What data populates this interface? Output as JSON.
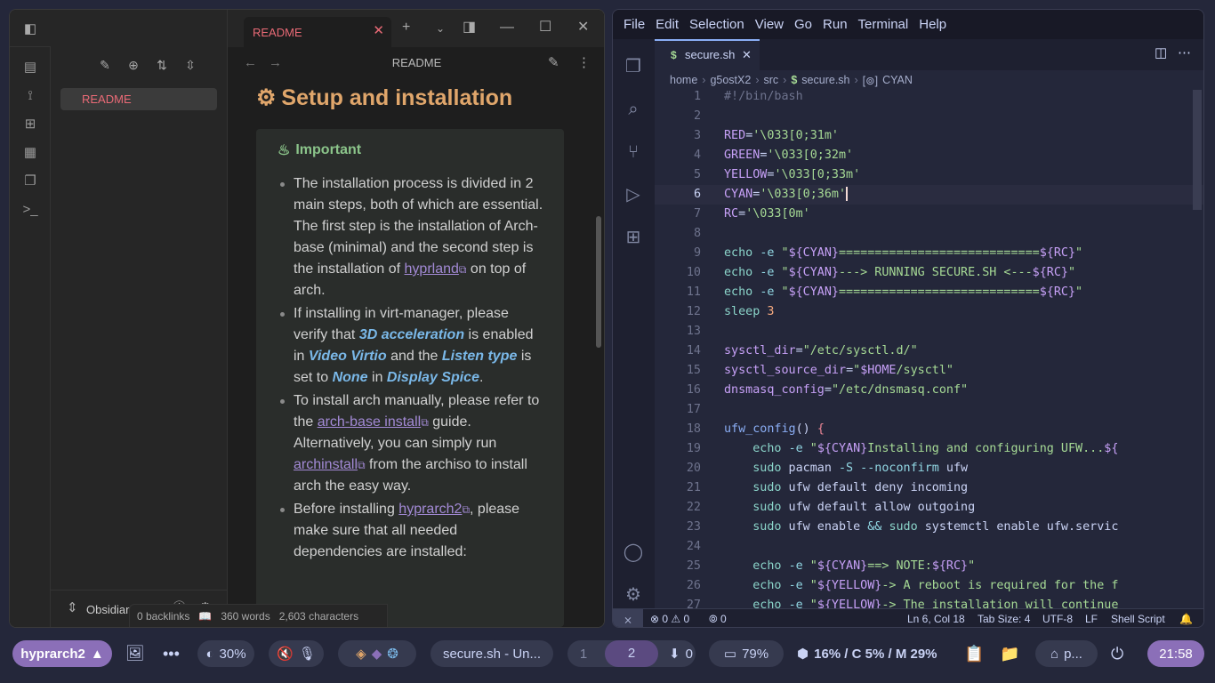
{
  "obsidian": {
    "tab_title": "README",
    "note_title": "README",
    "file_tree": [
      "README"
    ],
    "vault_name": "Obsidian V...",
    "heading": "Setup and installation",
    "callout_title": "Important",
    "bullets": {
      "b1_pre": "The installation process is divided in 2 main steps, both of which are essential. The first step is the installation of Arch-base (minimal) and the second step is the installation of ",
      "b1_link": "hyprland",
      "b1_post": " on top of arch.",
      "b2_a": "If installing in virt-manager, please verify that ",
      "b2_h1": "3D acceleration",
      "b2_b": " is enabled in ",
      "b2_h2": "Video Virtio",
      "b2_c": " and the ",
      "b2_h3": "Listen type",
      "b2_d": " is set to ",
      "b2_h4": "None",
      "b2_e": " in ",
      "b2_h5": "Display Spice",
      "b2_f": ".",
      "b3_a": "To install arch manually, please refer to the ",
      "b3_link1": "arch-base install",
      "b3_b": " guide. Alternatively, you can simply run ",
      "b3_link2": "archinstall",
      "b3_c": " from the archiso to install arch the easy way.",
      "b4_a": "Before installing ",
      "b4_link": "hyprarch2",
      "b4_b": ", please make sure that all needed dependencies are installed:"
    },
    "status": {
      "backlinks": "0 backlinks",
      "words": "360 words",
      "chars": "2,603 characters"
    }
  },
  "vscode": {
    "menu": [
      "File",
      "Edit",
      "Selection",
      "View",
      "Go",
      "Run",
      "Terminal",
      "Help"
    ],
    "tab_title": "secure.sh",
    "tab_icon": "$",
    "breadcrumb": [
      "home",
      "g5ostX2",
      "src",
      "secure.sh",
      "CYAN"
    ],
    "current_line": 6,
    "code_lines": [
      [
        [
          "c",
          "#!/bin/bash"
        ]
      ],
      [],
      [
        [
          "v",
          "RED"
        ],
        [
          "w",
          "="
        ],
        [
          "s",
          "'\\033[0;31m'"
        ]
      ],
      [
        [
          "v",
          "GREEN"
        ],
        [
          "w",
          "="
        ],
        [
          "s",
          "'\\033[0;32m'"
        ]
      ],
      [
        [
          "v",
          "YELLOW"
        ],
        [
          "w",
          "="
        ],
        [
          "s",
          "'\\033[0;33m'"
        ]
      ],
      [
        [
          "v",
          "CYAN"
        ],
        [
          "w",
          "="
        ],
        [
          "s",
          "'\\033[0;36m'"
        ]
      ],
      [
        [
          "v",
          "RC"
        ],
        [
          "w",
          "="
        ],
        [
          "s",
          "'\\033[0m'"
        ]
      ],
      [],
      [
        [
          "p",
          "echo"
        ],
        [
          "w",
          " "
        ],
        [
          "o",
          "-e"
        ],
        [
          "w",
          " "
        ],
        [
          "s",
          "\""
        ],
        [
          "v",
          "${CYAN}"
        ],
        [
          "s",
          "============================"
        ],
        [
          "v",
          "${RC}"
        ],
        [
          "s",
          "\""
        ]
      ],
      [
        [
          "p",
          "echo"
        ],
        [
          "w",
          " "
        ],
        [
          "o",
          "-e"
        ],
        [
          "w",
          " "
        ],
        [
          "s",
          "\""
        ],
        [
          "v",
          "${CYAN}"
        ],
        [
          "s",
          "---> RUNNING SECURE.SH <---"
        ],
        [
          "v",
          "${RC}"
        ],
        [
          "s",
          "\""
        ]
      ],
      [
        [
          "p",
          "echo"
        ],
        [
          "w",
          " "
        ],
        [
          "o",
          "-e"
        ],
        [
          "w",
          " "
        ],
        [
          "s",
          "\""
        ],
        [
          "v",
          "${CYAN}"
        ],
        [
          "s",
          "============================"
        ],
        [
          "v",
          "${RC}"
        ],
        [
          "s",
          "\""
        ]
      ],
      [
        [
          "p",
          "sleep"
        ],
        [
          "w",
          " "
        ],
        [
          "pk",
          "3"
        ]
      ],
      [],
      [
        [
          "v",
          "sysctl_dir"
        ],
        [
          "w",
          "="
        ],
        [
          "s",
          "\"/etc/sysctl.d/\""
        ]
      ],
      [
        [
          "v",
          "sysctl_source_dir"
        ],
        [
          "w",
          "="
        ],
        [
          "s",
          "\""
        ],
        [
          "v",
          "$HOME"
        ],
        [
          "s",
          "/sysctl\""
        ]
      ],
      [
        [
          "v",
          "dnsmasq_config"
        ],
        [
          "w",
          "="
        ],
        [
          "s",
          "\"/etc/dnsmasq.conf\""
        ]
      ],
      [],
      [
        [
          "f",
          "ufw_config"
        ],
        [
          "w",
          "() "
        ],
        [
          "r",
          "{"
        ]
      ],
      [
        [
          "w",
          "    "
        ],
        [
          "p",
          "echo"
        ],
        [
          "w",
          " "
        ],
        [
          "o",
          "-e"
        ],
        [
          "w",
          " "
        ],
        [
          "s",
          "\""
        ],
        [
          "v",
          "${CYAN}"
        ],
        [
          "s",
          "Installing and configuring UFW..."
        ],
        [
          "v",
          "${"
        ]
      ],
      [
        [
          "w",
          "    "
        ],
        [
          "p",
          "sudo"
        ],
        [
          "w",
          " pacman "
        ],
        [
          "o",
          "-S --noconfirm"
        ],
        [
          "w",
          " ufw"
        ]
      ],
      [
        [
          "w",
          "    "
        ],
        [
          "p",
          "sudo"
        ],
        [
          "w",
          " ufw default deny incoming"
        ]
      ],
      [
        [
          "w",
          "    "
        ],
        [
          "p",
          "sudo"
        ],
        [
          "w",
          " ufw default allow outgoing"
        ]
      ],
      [
        [
          "w",
          "    "
        ],
        [
          "p",
          "sudo"
        ],
        [
          "w",
          " ufw enable "
        ],
        [
          "o",
          "&&"
        ],
        [
          "w",
          " "
        ],
        [
          "p",
          "sudo"
        ],
        [
          "w",
          " systemctl enable ufw.servic"
        ]
      ],
      [],
      [
        [
          "w",
          "    "
        ],
        [
          "p",
          "echo"
        ],
        [
          "w",
          " "
        ],
        [
          "o",
          "-e"
        ],
        [
          "w",
          " "
        ],
        [
          "s",
          "\""
        ],
        [
          "v",
          "${CYAN}"
        ],
        [
          "s",
          "==> NOTE:"
        ],
        [
          "v",
          "${RC}"
        ],
        [
          "s",
          "\""
        ]
      ],
      [
        [
          "w",
          "    "
        ],
        [
          "p",
          "echo"
        ],
        [
          "w",
          " "
        ],
        [
          "o",
          "-e"
        ],
        [
          "w",
          " "
        ],
        [
          "s",
          "\""
        ],
        [
          "v",
          "${YELLOW}"
        ],
        [
          "s",
          "-> A reboot is required for the f"
        ]
      ],
      [
        [
          "w",
          "    "
        ],
        [
          "p",
          "echo"
        ],
        [
          "w",
          " "
        ],
        [
          "o",
          "-e"
        ],
        [
          "w",
          " "
        ],
        [
          "s",
          "\""
        ],
        [
          "v",
          "${YELLOW}"
        ],
        [
          "s",
          "-> The installation will continue"
        ]
      ]
    ],
    "status": {
      "errors": "0",
      "warnings": "0",
      "ports": "0",
      "position": "Ln 6, Col 18",
      "tabsize": "Tab Size: 4",
      "encoding": "UTF-8",
      "eol": "LF",
      "language": "Shell Script"
    }
  },
  "waybar": {
    "distro": "hyprarch2",
    "brightness": "30%",
    "window_title": "secure.sh - Un...",
    "workspaces": [
      "1",
      "2"
    ],
    "updates": "0",
    "battery": "79%",
    "resources": "16% / C 5% / M 29%",
    "user_short": "p...",
    "clock": "21:58"
  },
  "colors": {
    "accent": "#e96a76",
    "heading": "#e0a66b",
    "callout": "#8bc48a",
    "link": "#a38ad6",
    "highlight": "#7ab8e8"
  }
}
